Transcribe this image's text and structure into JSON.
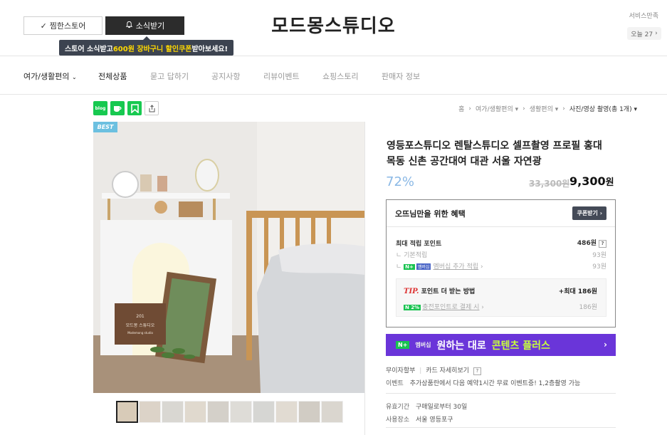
{
  "header": {
    "fav_button": "찜한스토어",
    "noti_button": "소식받기",
    "tooltip_pre": "스토어 소식받고 ",
    "tooltip_hl": "600원 장바구니 할인쿠폰",
    "tooltip_post": " 받아보세요!",
    "store_name": "모드몽스튜디오",
    "service_label": "서비스만족",
    "service_sub": "오늘 27"
  },
  "nav": {
    "category": "여가/생활편의",
    "items": [
      "전체상품",
      "묻고 답하기",
      "공지사항",
      "리뷰이벤트",
      "쇼핑스토리",
      "판매자 정보"
    ]
  },
  "share": {
    "blog": "blog"
  },
  "breadcrumb": {
    "home": "홈",
    "c1": "여가/생활편의",
    "c2": "생활편의",
    "current": "사진/영상 촬영(총 1개)"
  },
  "product": {
    "badge": "BEST",
    "title": "영등포스튜디오 렌탈스튜디오 셀프촬영 프로필 홍대 목동 신촌 공간대여 대관 서울 자연광",
    "discount": "72%",
    "original_price": "33,300원",
    "sale_price": "9,300",
    "sale_unit": "원",
    "sign_text": "201 모드몽 스튜디오 Modemong studio"
  },
  "benefit": {
    "title": "오뜨님만을 위한 혜택",
    "coupon_button": "쿠폰받기",
    "max_point_label": "최대 적립 포인트",
    "max_point_value": "486원",
    "basic_label": "기본적립",
    "basic_value": "93원",
    "membership_badge": "멤버십",
    "membership_label": "멤버십 추가 적립",
    "membership_value": "93원",
    "tip_logo": "TIP.",
    "tip_label": "포인트 더 받는 방법",
    "tip_value": "+최대 186원",
    "charge_badge": "2%",
    "charge_label": "충전포인트로 결제 시",
    "charge_value": "186원"
  },
  "banner": {
    "nplus": "N+",
    "member": "멤버십",
    "text1": "원하는 대로",
    "text2": "콘텐츠 플러스"
  },
  "info": {
    "free_installment": "무이자할부",
    "card_link": "카드 자세히보기",
    "event_key": "이벤트",
    "event_val": "추가상품란에서 다음 예약1시간 무료 이벤트중! 1,2층촬영 가능",
    "valid_key": "유효기간",
    "valid_val": "구매일로부터 30일",
    "place_key": "사용장소",
    "place_val": "서울 영등포구"
  },
  "colors": {
    "accent_green": "#19c350",
    "banner_purple": "#6a35d9",
    "discount_blue": "#8ab8e5",
    "tip_red": "#d33333"
  }
}
